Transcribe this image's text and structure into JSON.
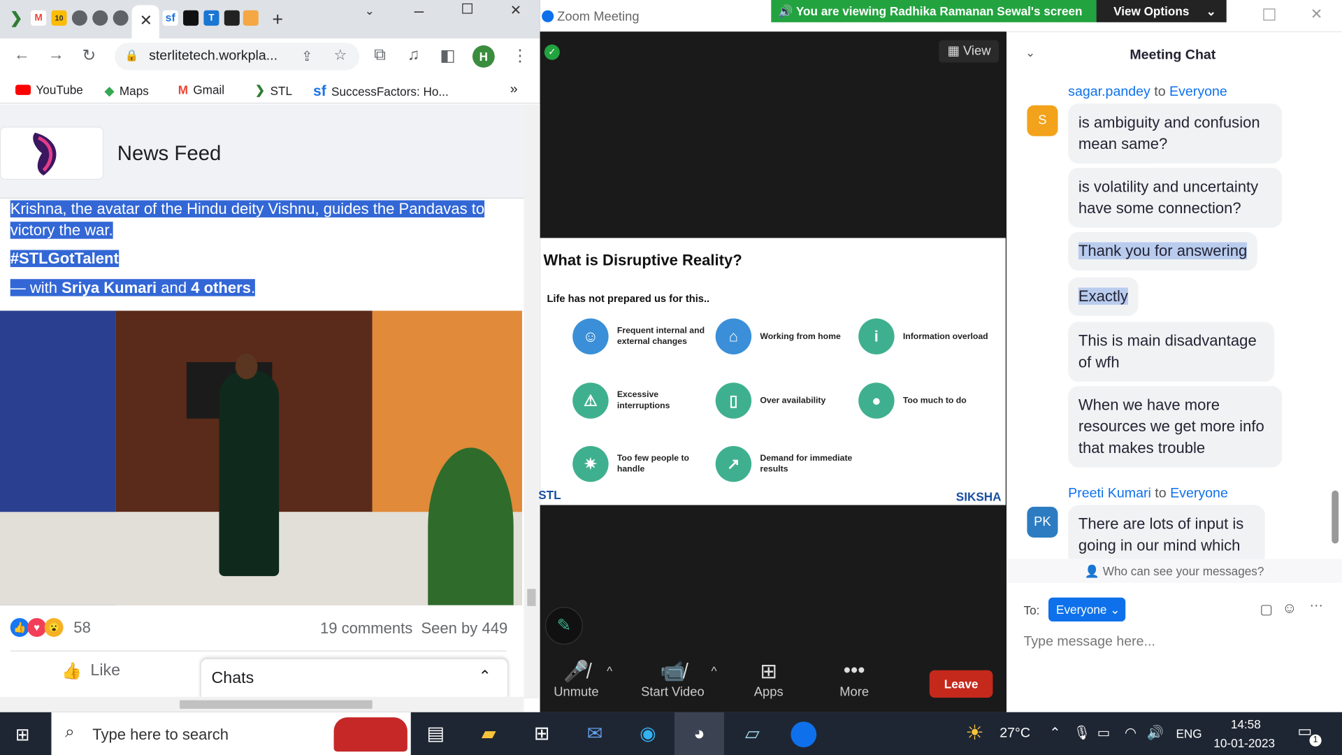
{
  "chrome": {
    "address": "sterlitetech.workpla...",
    "profile_initial": "H",
    "bookmarks": [
      "YouTube",
      "Maps",
      "Gmail",
      "STL",
      "SuccessFactors: Ho..."
    ],
    "more_bookmarks": "»"
  },
  "feed": {
    "title": "News Feed",
    "line1": "Krishna, the avatar of the Hindu deity Vishnu, guides the Pandavas to",
    "line2": "victory the war.",
    "hashtag": "#STLGotTalent",
    "with_prefix": "— with ",
    "with_person": "Sriya Kumari",
    "with_and": " and ",
    "with_others": "4 others",
    "with_end": ".",
    "reactions_count": "58",
    "comments": "19 comments",
    "seen": "Seen by 449",
    "like": "Like",
    "chats": "Chats"
  },
  "zoom": {
    "window_title": "Zoom Meeting",
    "sharing_banner": "You are viewing Radhika Ramanan Sewal's screen",
    "view_options": "View Options",
    "view_button": "View",
    "slide": {
      "title": "What is Disruptive Reality?",
      "subtitle": "Life has not prepared us for this..",
      "items": [
        "Frequent internal and external changes",
        "Working from home",
        "Information overload",
        "Excessive interruptions",
        "Over availability",
        "Too much to do",
        "Too few people to handle",
        "Demand for immediate results"
      ],
      "brand_left": "STL",
      "brand_right": "SIKSHA"
    },
    "controls": {
      "unmute": "Unmute",
      "start_video": "Start Video",
      "apps": "Apps",
      "more": "More",
      "leave": "Leave"
    },
    "chat": {
      "title": "Meeting Chat",
      "sender1": "sagar.pandey",
      "to_word": " to ",
      "everyone": "Everyone",
      "avatar1": "S",
      "messages1": [
        "is ambiguity and confusion mean same?",
        "is volatility and uncertainty have some connection?",
        "Thank you for answering",
        "Exactly",
        "This is main disadvantage of wfh",
        "When we have more resources we get more info that makes trouble"
      ],
      "sender2": "Preeti Kumari",
      "avatar2": "PK",
      "messages2": [
        "There are lots of input is going in our mind which"
      ],
      "who_can_see": "Who can see your messages?",
      "to_label": "To:",
      "to_value": "Everyone",
      "placeholder": "Type message here..."
    }
  },
  "taskbar": {
    "search_placeholder": "Type here to search",
    "temperature": "27°C",
    "language": "ENG",
    "time": "14:58",
    "date": "10-01-2023",
    "notifications": "1"
  },
  "colors": {
    "zoom_green": "#23a33f",
    "zoom_blue": "#0e71eb",
    "leave_red": "#c4291c",
    "slide_teal": "#3fb08f",
    "slide_blue": "#3a8fd8"
  }
}
